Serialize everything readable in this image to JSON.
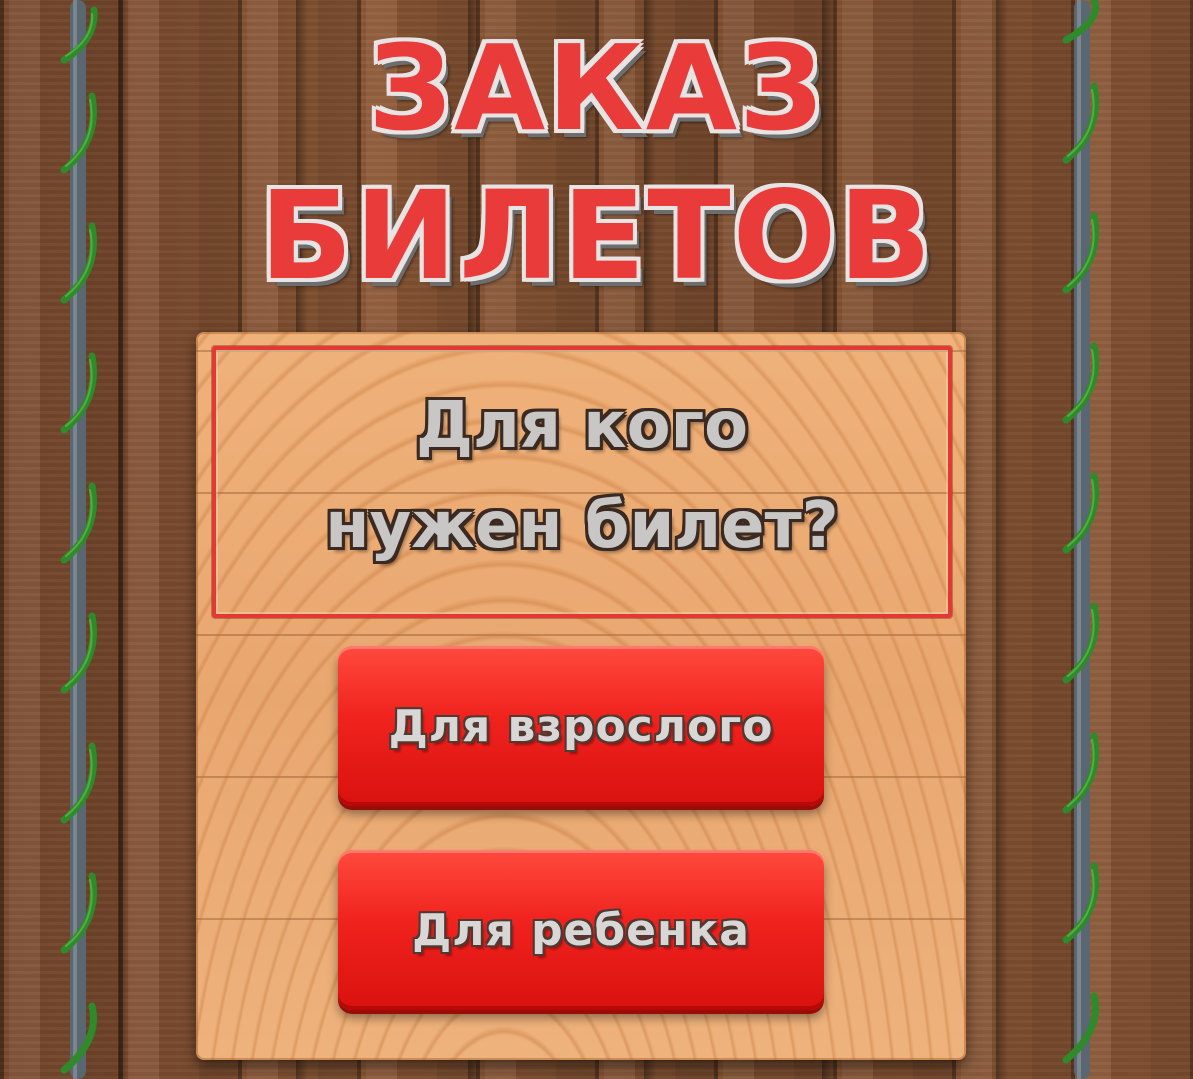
{
  "title": {
    "line1": "ЗАКАЗ",
    "line2": "БИЛЕТОВ"
  },
  "question": {
    "line1": "Для кого",
    "line2": "нужен билет?"
  },
  "buttons": {
    "adult_label": "Для взрослого",
    "child_label": "Для ребенка"
  },
  "colors": {
    "accent_red": "#ea3b3b",
    "button_red": "#f0221e",
    "board_wood": "#e9a770",
    "background_wood": "#7f4f30",
    "rope_green": "#2f8a2a",
    "pole_gray": "#5a6670"
  },
  "icons": {
    "left_decoration": "rope-vine-icon",
    "right_decoration": "rope-vine-icon"
  }
}
